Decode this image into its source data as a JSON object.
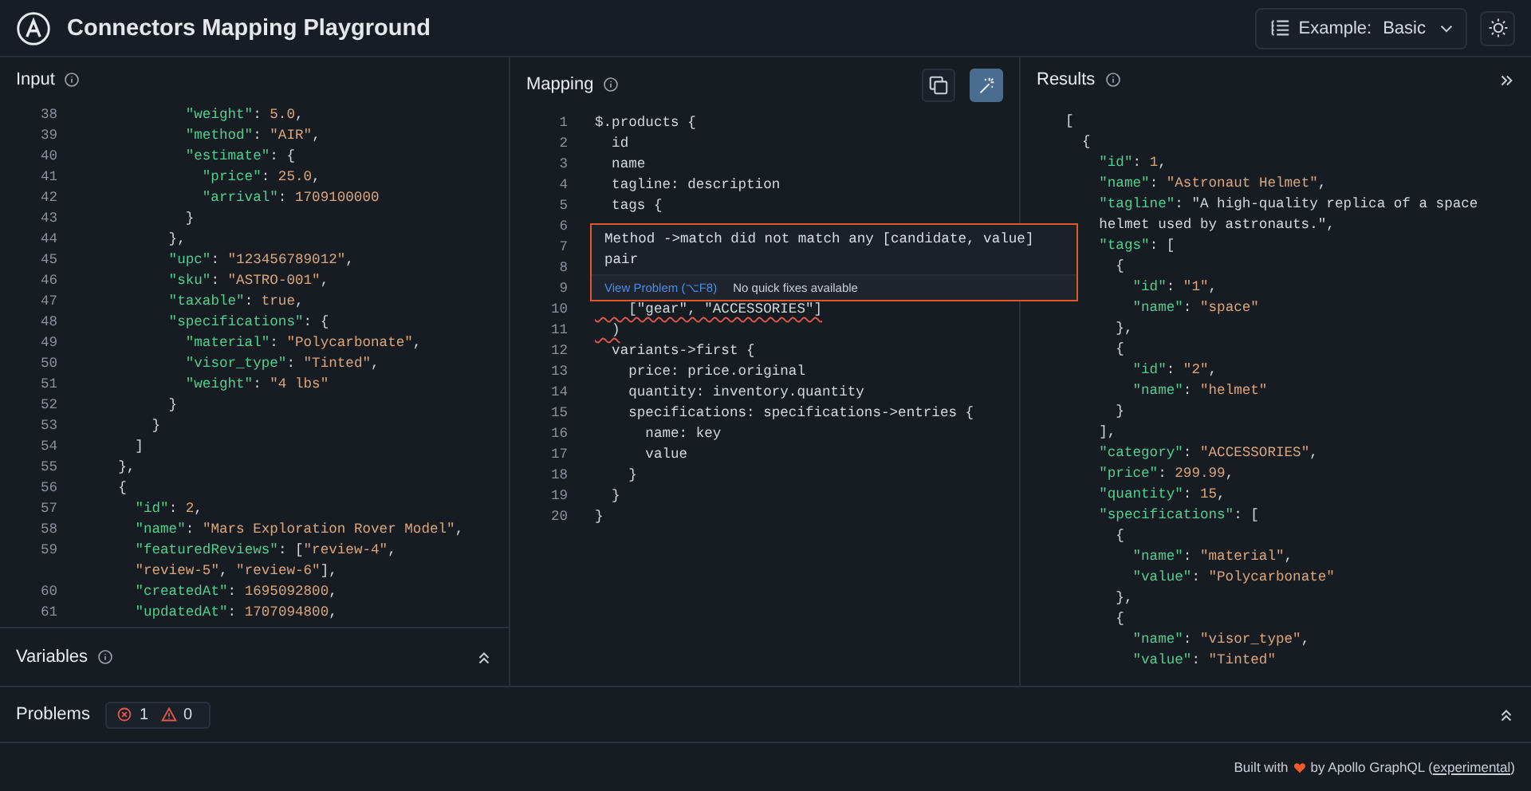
{
  "header": {
    "title": "Connectors Mapping Playground",
    "example_select": {
      "label": "Example:",
      "value": "Basic"
    }
  },
  "input": {
    "title": "Input",
    "lines": [
      {
        "number": "38",
        "text": "            \"weight\": 5.0,"
      },
      {
        "number": "39",
        "text": "            \"method\": \"AIR\","
      },
      {
        "number": "40",
        "text": "            \"estimate\": {"
      },
      {
        "number": "41",
        "text": "              \"price\": 25.0,"
      },
      {
        "number": "42",
        "text": "              \"arrival\": 1709100000"
      },
      {
        "number": "43",
        "text": "            }"
      },
      {
        "number": "44",
        "text": "          },"
      },
      {
        "number": "45",
        "text": "          \"upc\": \"123456789012\","
      },
      {
        "number": "46",
        "text": "          \"sku\": \"ASTRO-001\","
      },
      {
        "number": "47",
        "text": "          \"taxable\": true,"
      },
      {
        "number": "48",
        "text": "          \"specifications\": {"
      },
      {
        "number": "49",
        "text": "            \"material\": \"Polycarbonate\","
      },
      {
        "number": "50",
        "text": "            \"visor_type\": \"Tinted\","
      },
      {
        "number": "51",
        "text": "            \"weight\": \"4 lbs\""
      },
      {
        "number": "52",
        "text": "          }"
      },
      {
        "number": "53",
        "text": "        }"
      },
      {
        "number": "54",
        "text": "      ]"
      },
      {
        "number": "55",
        "text": "    },"
      },
      {
        "number": "56",
        "text": "    {"
      },
      {
        "number": "57",
        "text": "      \"id\": 2,"
      },
      {
        "number": "58",
        "text": "      \"name\": \"Mars Exploration Rover Model\","
      },
      {
        "number": "59",
        "text": "      \"featuredReviews\": [\"review-4\",",
        "continuation": "      \"review-5\", \"review-6\"],"
      },
      {
        "number": "60",
        "text": "      \"createdAt\": 1695092800,"
      },
      {
        "number": "61",
        "text": "      \"updatedAt\": 1707094800,"
      }
    ]
  },
  "variables": {
    "title": "Variables"
  },
  "mapping": {
    "title": "Mapping",
    "lines": [
      {
        "number": "1",
        "text": "$.products {"
      },
      {
        "number": "2",
        "text": "  id"
      },
      {
        "number": "3",
        "text": "  name"
      },
      {
        "number": "4",
        "text": "  tagline: description"
      },
      {
        "number": "5",
        "text": "  tags {"
      },
      {
        "number": "6"
      },
      {
        "number": "7"
      },
      {
        "number": "8"
      },
      {
        "number": "9"
      },
      {
        "number": "10",
        "text": "    [\"gear\", \"ACCESSORIES\"]",
        "error": true
      },
      {
        "number": "11",
        "text": "  )",
        "error": true
      },
      {
        "number": "12",
        "text": "  variants->first {"
      },
      {
        "number": "13",
        "text": "    price: price.original"
      },
      {
        "number": "14",
        "text": "    quantity: inventory.quantity"
      },
      {
        "number": "15",
        "text": "    specifications: specifications->entries {"
      },
      {
        "number": "16",
        "text": "      name: key"
      },
      {
        "number": "17",
        "text": "      value"
      },
      {
        "number": "18",
        "text": "    }"
      },
      {
        "number": "19",
        "text": "  }"
      },
      {
        "number": "20",
        "text": "}"
      }
    ],
    "tooltip": {
      "message": "Method ->match did not match any [candidate, value] pair",
      "link": "View Problem (⌥F8)",
      "note": "No quick fixes available"
    }
  },
  "results": {
    "title": "Results",
    "lines": [
      {
        "text": "["
      },
      {
        "text": "  {"
      },
      {
        "text": "    \"id\": 1,"
      },
      {
        "text": "    \"name\": \"Astronaut Helmet\","
      },
      {
        "text": "    \"tagline\": \"A high-quality replica of a space",
        "continuation": "    helmet used by astronauts.\","
      },
      {
        "text": "    \"tags\": ["
      },
      {
        "text": "      {"
      },
      {
        "text": "        \"id\": \"1\","
      },
      {
        "text": "        \"name\": \"space\""
      },
      {
        "text": "      },"
      },
      {
        "text": "      {"
      },
      {
        "text": "        \"id\": \"2\","
      },
      {
        "text": "        \"name\": \"helmet\""
      },
      {
        "text": "      }"
      },
      {
        "text": "    ],"
      },
      {
        "text": "    \"category\": \"ACCESSORIES\","
      },
      {
        "text": "    \"price\": 299.99,"
      },
      {
        "text": "    \"quantity\": 15,"
      },
      {
        "text": "    \"specifications\": ["
      },
      {
        "text": "      {"
      },
      {
        "text": "        \"name\": \"material\","
      },
      {
        "text": "        \"value\": \"Polycarbonate\""
      },
      {
        "text": "      },"
      },
      {
        "text": "      {"
      },
      {
        "text": "        \"name\": \"visor_type\","
      },
      {
        "text": "        \"value\": \"Tinted\""
      }
    ]
  },
  "problems": {
    "title": "Problems",
    "errors": "1",
    "warnings": "0"
  },
  "footer": {
    "before": "Built with",
    "after": "by Apollo GraphQL (",
    "link": "experimental",
    "close": ")"
  }
}
